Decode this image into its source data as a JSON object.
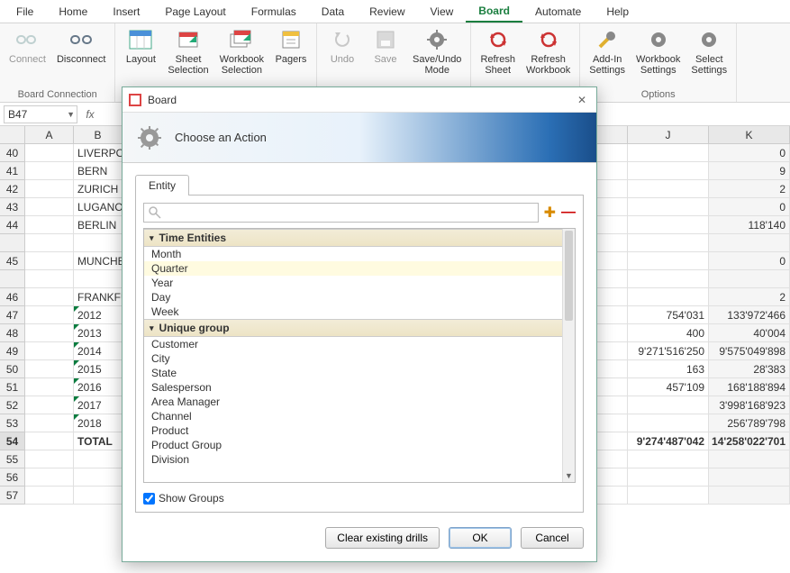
{
  "ribbon": {
    "tabs": [
      "File",
      "Home",
      "Insert",
      "Page Layout",
      "Formulas",
      "Data",
      "Review",
      "View",
      "Board",
      "Automate",
      "Help"
    ],
    "active_tab": "Board",
    "groups": {
      "board_connection": {
        "label": "Board Connection",
        "connect": "Connect",
        "disconnect": "Disconnect"
      },
      "layout_grp": {
        "layout": "Layout",
        "sheet_selection": "Sheet\nSelection",
        "workbook_selection": "Workbook\nSelection",
        "pagers": "Pagers"
      },
      "undo_grp": {
        "undo": "Undo",
        "save": "Save",
        "saveundo": "Save/Undo\nMode"
      },
      "refresh_grp": {
        "refresh_sheet": "Refresh\nSheet",
        "refresh_wb": "Refresh\nWorkbook"
      },
      "options": {
        "label": "Options",
        "addin": "Add-In\nSettings",
        "workbook": "Workbook\nSettings",
        "select": "Select\nSettings"
      }
    }
  },
  "name_box": "B47",
  "columns": [
    "A",
    "B",
    "J",
    "K"
  ],
  "rows": [
    {
      "n": "40",
      "b": "LIVERPOOL",
      "k": "0"
    },
    {
      "n": "41",
      "b": "BERN",
      "k": "9"
    },
    {
      "n": "42",
      "b": "ZURICH",
      "k": "2"
    },
    {
      "n": "43",
      "b": "LUGANO",
      "k": "0"
    },
    {
      "n": "44",
      "b": "BERLIN",
      "k": "118'140"
    },
    {
      "n": "",
      "b": ""
    },
    {
      "n": "45",
      "b": "MUNCHEN",
      "k": "0"
    },
    {
      "n": "",
      "b": ""
    },
    {
      "n": "46",
      "b": "FRANKFURT",
      "k": "2"
    },
    {
      "n": "47",
      "b": "2012",
      "j": "754'031",
      "k": "133'972'466",
      "tri": true
    },
    {
      "n": "48",
      "b": "2013",
      "j": "400",
      "k": "40'004",
      "tri": true
    },
    {
      "n": "49",
      "b": "2014",
      "j": "9'271'516'250",
      "k": "9'575'049'898",
      "tri": true
    },
    {
      "n": "50",
      "b": "2015",
      "j": "163",
      "k": "28'383",
      "tri": true
    },
    {
      "n": "51",
      "b": "2016",
      "j": "457'109",
      "k": "168'188'894",
      "tri": true
    },
    {
      "n": "52",
      "b": "2017",
      "j": "",
      "k": "3'998'168'923",
      "tri": true
    },
    {
      "n": "53",
      "b": "2018",
      "j": "",
      "k": "256'789'798",
      "tri": true
    },
    {
      "n": "54",
      "b": "TOTAL",
      "j": "9'274'487'042",
      "k": "14'258'022'701",
      "total": true
    },
    {
      "n": "55",
      "b": ""
    },
    {
      "n": "56",
      "b": ""
    },
    {
      "n": "57",
      "b": ""
    }
  ],
  "dialog": {
    "title": "Board",
    "banner": "Choose an Action",
    "tab": "Entity",
    "groups": [
      {
        "name": "Time Entities",
        "items": [
          "Month",
          "Quarter",
          "Year",
          "Day",
          "Week"
        ],
        "selected": "Quarter"
      },
      {
        "name": "Unique group",
        "items": [
          "Customer",
          "City",
          "State",
          "Salesperson",
          "Area Manager",
          "Channel",
          "Product",
          "Product Group",
          "Division"
        ]
      }
    ],
    "show_groups": "Show Groups",
    "btn_clear": "Clear existing drills",
    "btn_ok": "OK",
    "btn_cancel": "Cancel"
  }
}
